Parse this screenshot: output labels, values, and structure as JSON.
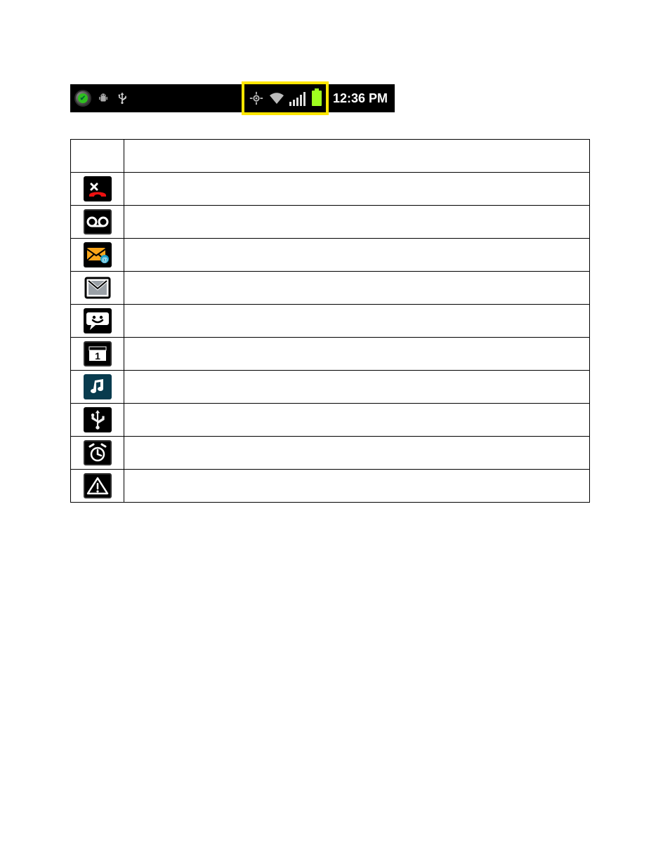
{
  "status_bar": {
    "time": "12:36 PM",
    "left_icons": [
      {
        "name": "status-ok-icon"
      },
      {
        "name": "android-debug-icon"
      },
      {
        "name": "usb-icon"
      }
    ],
    "highlighted_icons": [
      {
        "name": "gps-icon"
      },
      {
        "name": "wifi-icon"
      },
      {
        "name": "signal-icon"
      },
      {
        "name": "battery-icon"
      }
    ]
  },
  "table": {
    "header": {
      "icon_col": "",
      "desc_col": ""
    },
    "rows": [
      {
        "icon": "missed-call-icon",
        "desc": ""
      },
      {
        "icon": "voicemail-icon",
        "desc": ""
      },
      {
        "icon": "new-email-icon",
        "desc": ""
      },
      {
        "icon": "gmail-icon",
        "desc": ""
      },
      {
        "icon": "new-message-icon",
        "desc": ""
      },
      {
        "icon": "calendar-event-icon",
        "desc": ""
      },
      {
        "icon": "music-playing-icon",
        "desc": ""
      },
      {
        "icon": "usb-connected-icon",
        "desc": ""
      },
      {
        "icon": "alarm-set-icon",
        "desc": ""
      },
      {
        "icon": "warning-icon",
        "desc": ""
      }
    ]
  }
}
